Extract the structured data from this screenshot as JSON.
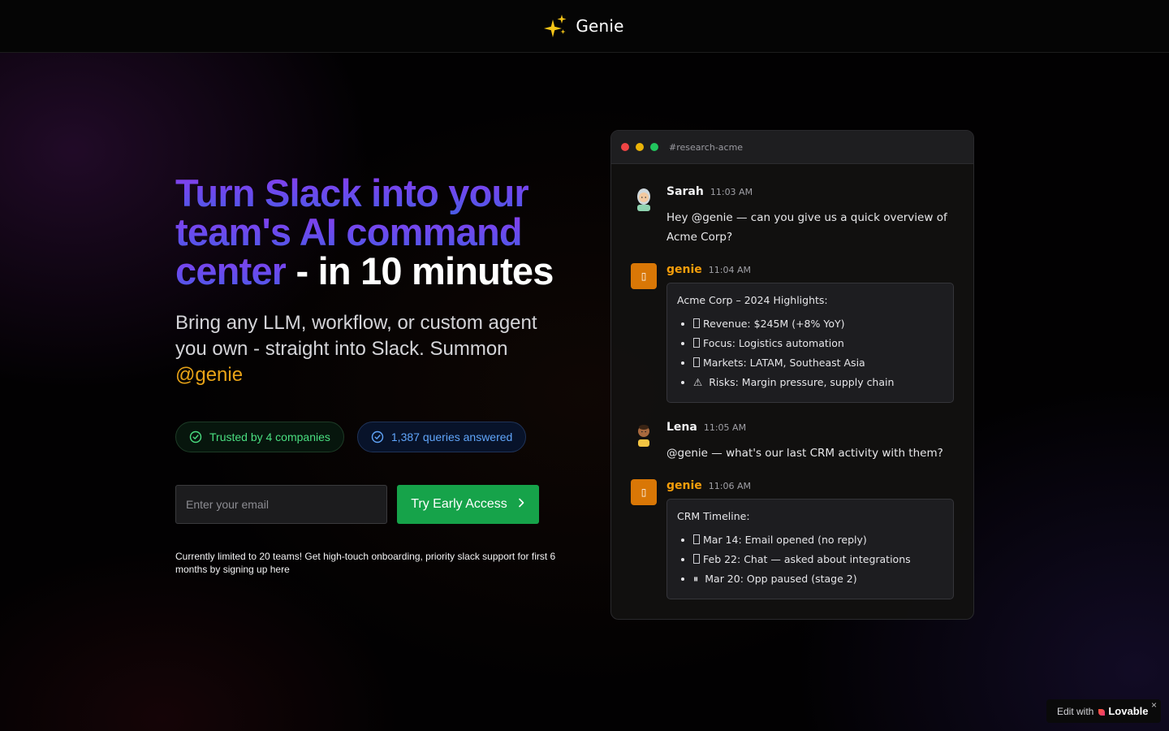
{
  "header": {
    "brand_name": "Genie",
    "logo_icon": "sparkles-icon"
  },
  "hero": {
    "headline_gradient": "Turn Slack into your team's AI command center",
    "headline_white": " - in 10 minutes",
    "subhead_text": "Bring any LLM, workflow, or custom agent you own - straight into Slack. Summon ",
    "subhead_mention": "@genie",
    "badges": [
      {
        "label": "Trusted by 4 companies",
        "icon": "check-circle-icon",
        "color": "#4ade80"
      },
      {
        "label": "1,387 queries answered",
        "icon": "check-circle-icon",
        "color": "#60a5fa"
      }
    ],
    "email_placeholder": "Enter your email",
    "cta_label": "Try Early Access",
    "fineprint": "Currently limited to 20 teams! Get high-touch onboarding, priority slack support for first 6 months by signing up here"
  },
  "chat": {
    "channel": "#research-acme",
    "messages": [
      {
        "author": "Sarah",
        "time": "11:03 AM",
        "text": "Hey @genie — can you give us a quick overview of Acme Corp?"
      },
      {
        "author": "genie",
        "time": "11:04 AM",
        "card_title": "Acme Corp – 2024 Highlights:",
        "items": [
          "Revenue: $245M (+8% YoY)",
          "Focus: Logistics automation",
          "Markets: LATAM, Southeast Asia",
          "Risks: Margin pressure, supply chain"
        ],
        "item_icons": [
          "",
          "",
          "",
          "⚠"
        ]
      },
      {
        "author": "Lena",
        "time": "11:05 AM",
        "text": "@genie — what's our last CRM activity with them?"
      },
      {
        "author": "genie",
        "time": "11:06 AM",
        "card_title": "CRM Timeline:",
        "items": [
          "Mar 14: Email opened (no reply)",
          "Feb 22: Chat — asked about integrations",
          "Mar 20: Opp paused (stage 2)"
        ],
        "item_icons": [
          "",
          "",
          "⏸"
        ]
      }
    ]
  },
  "lovable_badge": {
    "prefix": "Edit with",
    "name": "Lovable",
    "close": "×"
  },
  "colors": {
    "accent_green": "#16a34a",
    "mention_orange": "#e8a317",
    "headline_purple": "#8b3de8",
    "headline_blue": "#4a5be6",
    "bot_orange": "#d97706"
  }
}
